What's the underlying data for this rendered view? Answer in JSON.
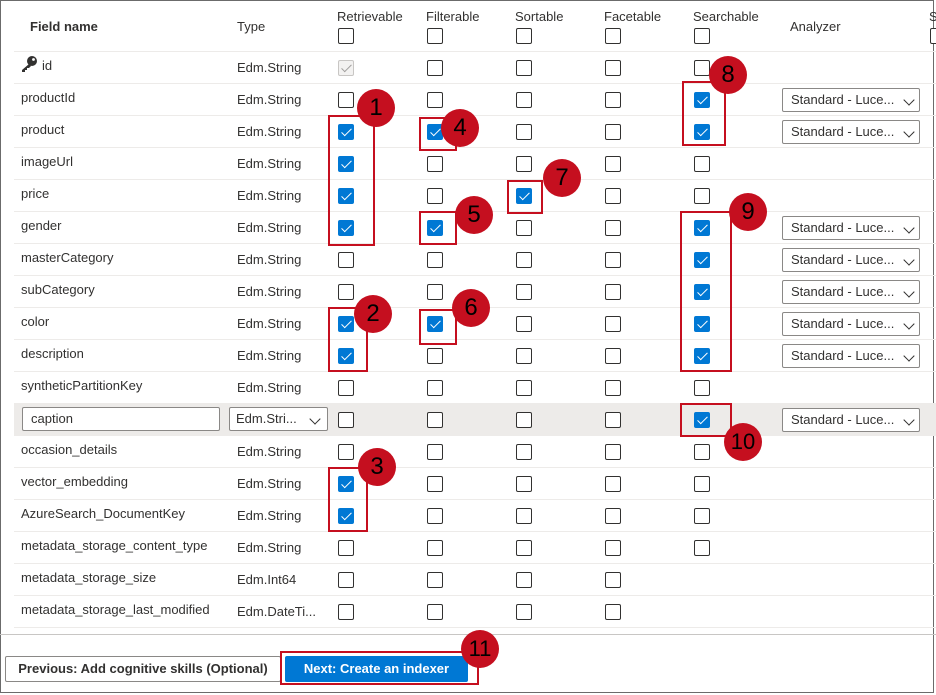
{
  "columns": {
    "field_name": "Field name",
    "type": "Type",
    "retrievable": "Retrievable",
    "filterable": "Filterable",
    "sortable": "Sortable",
    "facetable": "Facetable",
    "searchable": "Searchable",
    "analyzer": "Analyzer",
    "cut_off": "S"
  },
  "fields": [
    {
      "name": "id",
      "type": "Edm.String",
      "retrievable": true,
      "retrievable_disabled": true,
      "filterable": false,
      "sortable": false,
      "facetable": false,
      "searchable": false,
      "analyzer": ""
    },
    {
      "name": "productId",
      "type": "Edm.String",
      "retrievable": false,
      "filterable": false,
      "sortable": false,
      "facetable": false,
      "searchable": true,
      "analyzer": "Standard - Luce..."
    },
    {
      "name": "product",
      "type": "Edm.String",
      "retrievable": true,
      "filterable": true,
      "sortable": false,
      "facetable": false,
      "searchable": true,
      "analyzer": "Standard - Luce..."
    },
    {
      "name": "imageUrl",
      "type": "Edm.String",
      "retrievable": true,
      "filterable": false,
      "sortable": false,
      "facetable": false,
      "searchable": false,
      "analyzer": ""
    },
    {
      "name": "price",
      "type": "Edm.String",
      "retrievable": true,
      "filterable": false,
      "sortable": true,
      "facetable": false,
      "searchable": false,
      "analyzer": ""
    },
    {
      "name": "gender",
      "type": "Edm.String",
      "retrievable": true,
      "filterable": true,
      "sortable": false,
      "facetable": false,
      "searchable": true,
      "analyzer": "Standard - Luce..."
    },
    {
      "name": "masterCategory",
      "type": "Edm.String",
      "retrievable": false,
      "filterable": false,
      "sortable": false,
      "facetable": false,
      "searchable": true,
      "analyzer": "Standard - Luce..."
    },
    {
      "name": "subCategory",
      "type": "Edm.String",
      "retrievable": false,
      "filterable": false,
      "sortable": false,
      "facetable": false,
      "searchable": true,
      "analyzer": "Standard - Luce..."
    },
    {
      "name": "color",
      "type": "Edm.String",
      "retrievable": true,
      "filterable": true,
      "sortable": false,
      "facetable": false,
      "searchable": true,
      "analyzer": "Standard - Luce..."
    },
    {
      "name": "description",
      "type": "Edm.String",
      "retrievable": true,
      "filterable": false,
      "sortable": false,
      "facetable": false,
      "searchable": true,
      "analyzer": "Standard - Luce..."
    },
    {
      "name": "syntheticPartitionKey",
      "type": "Edm.String",
      "retrievable": false,
      "filterable": false,
      "sortable": false,
      "facetable": false,
      "searchable": false,
      "analyzer": ""
    },
    {
      "name": "caption",
      "type": "Edm.Stri...",
      "editable": true,
      "retrievable": false,
      "filterable": false,
      "sortable": false,
      "facetable": false,
      "searchable": true,
      "analyzer": "Standard - Luce..."
    },
    {
      "name": "occasion_details",
      "type": "Edm.String",
      "retrievable": false,
      "filterable": false,
      "sortable": false,
      "facetable": false,
      "searchable": false,
      "analyzer": ""
    },
    {
      "name": "vector_embedding",
      "type": "Edm.String",
      "retrievable": true,
      "filterable": false,
      "sortable": false,
      "facetable": false,
      "searchable": false,
      "analyzer": ""
    },
    {
      "name": "AzureSearch_DocumentKey",
      "type": "Edm.String",
      "retrievable": true,
      "filterable": false,
      "sortable": false,
      "facetable": false,
      "searchable": false,
      "analyzer": ""
    },
    {
      "name": "metadata_storage_content_type",
      "type": "Edm.String",
      "retrievable": false,
      "filterable": false,
      "sortable": false,
      "facetable": false,
      "searchable": false,
      "analyzer": ""
    },
    {
      "name": "metadata_storage_size",
      "type": "Edm.Int64",
      "retrievable": false,
      "filterable": false,
      "sortable": false,
      "facetable": false,
      "searchable": null,
      "analyzer": ""
    },
    {
      "name": "metadata_storage_last_modified",
      "type": "Edm.DateTi...",
      "retrievable": false,
      "filterable": false,
      "sortable": false,
      "facetable": false,
      "searchable": null,
      "analyzer": ""
    }
  ],
  "buttons": {
    "previous": "Previous: Add cognitive skills (Optional)",
    "next": "Next: Create an indexer"
  },
  "callouts": [
    "1",
    "2",
    "3",
    "4",
    "5",
    "6",
    "7",
    "8",
    "9",
    "10",
    "11"
  ],
  "colors": {
    "accent": "#0078d4",
    "callout": "#c50f1f"
  }
}
